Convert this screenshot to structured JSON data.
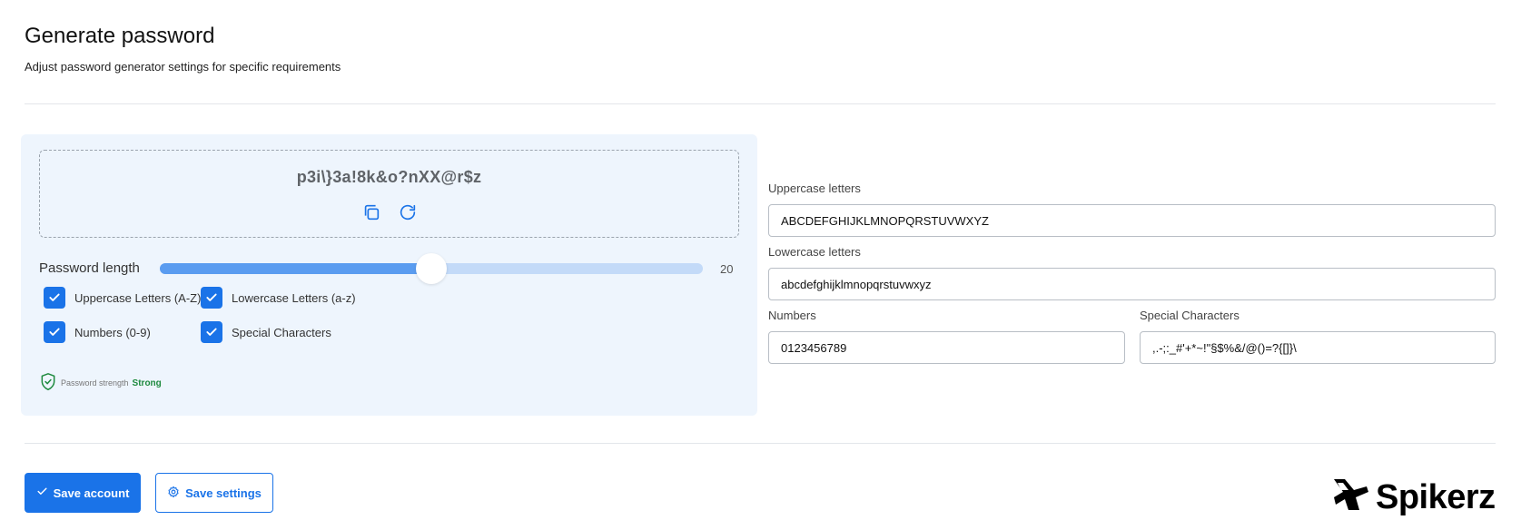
{
  "header": {
    "title": "Generate password",
    "subtitle": "Adjust password generator settings for specific requirements"
  },
  "generator": {
    "password": "p3i\\}3a!8k&o?nXX@r$z",
    "copy_icon": "copy-icon",
    "refresh_icon": "refresh-icon",
    "length_label": "Password length",
    "length_value": "20",
    "length_fraction": 0.5,
    "options": [
      {
        "label": "Uppercase Letters (A-Z)",
        "checked": true
      },
      {
        "label": "Lowercase Letters (a-z)",
        "checked": true
      },
      {
        "label": "Numbers (0-9)",
        "checked": true
      },
      {
        "label": "Special Characters",
        "checked": true
      }
    ],
    "strength_label": "Password strength",
    "strength_value": "Strong"
  },
  "fields": {
    "uppercase": {
      "label": "Uppercase letters",
      "value": "ABCDEFGHIJKLMNOPQRSTUVWXYZ"
    },
    "lowercase": {
      "label": "Lowercase letters",
      "value": "abcdefghijklmnopqrstuvwxyz"
    },
    "numbers": {
      "label": "Numbers",
      "value": "0123456789"
    },
    "special": {
      "label": "Special Characters",
      "value": ",.-;:_#'+*~!\"§$%&/@()=?{[]}\\"
    }
  },
  "actions": {
    "save_account": "Save account",
    "save_settings": "Save settings"
  },
  "brand": {
    "name": "Spikerz"
  },
  "colors": {
    "accent": "#1a73e8",
    "panel_bg": "#eef5fd",
    "strength_good": "#1e8a3e"
  }
}
